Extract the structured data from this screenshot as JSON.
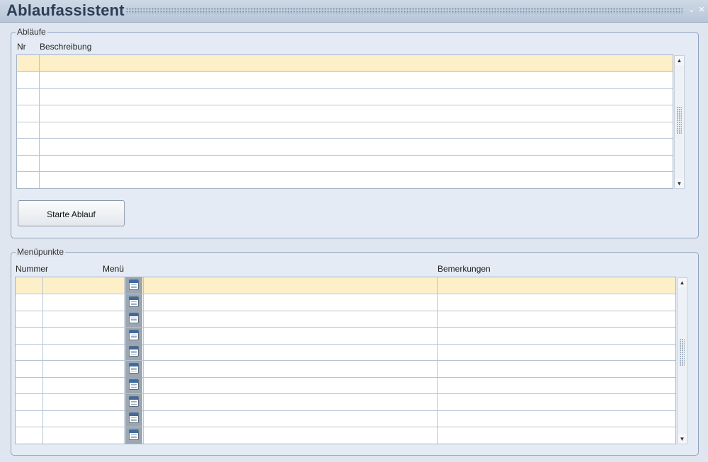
{
  "window": {
    "title": "Ablaufassistent",
    "minimize_glyph": "⌄",
    "close_glyph": "✕"
  },
  "ablaeufe": {
    "legend": "Abläufe",
    "columns": [
      "Nr",
      "Beschreibung"
    ],
    "row_count": 8,
    "start_button_label": "Starte Ablauf"
  },
  "menuepunkte": {
    "legend": "Menüpunkte",
    "columns": [
      "Nummer",
      "Menü",
      "Bemerkungen"
    ],
    "row_count": 10
  },
  "icons": {
    "menu_picker": "calendar-list-icon",
    "scroll_up": "arrow-up-icon",
    "scroll_down": "arrow-down-icon"
  },
  "colors": {
    "active_row": "#fdefc7",
    "title_text": "#2c3e55"
  }
}
